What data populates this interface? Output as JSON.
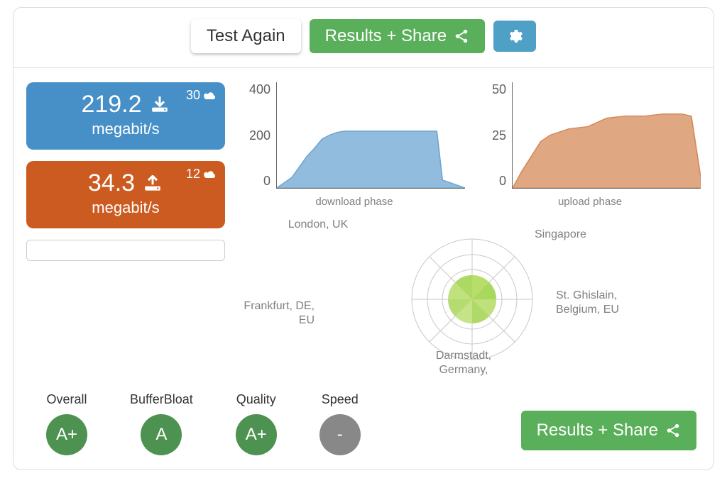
{
  "topbar": {
    "test_again": "Test Again",
    "results_share": "Results + Share"
  },
  "download": {
    "value": "219.2",
    "unit": "megabit/s",
    "servers": "30"
  },
  "upload": {
    "value": "34.3",
    "unit": "megabit/s",
    "servers": "12"
  },
  "chart_labels": {
    "download": "download phase",
    "upload": "upload phase"
  },
  "radar": {
    "london": "London, UK",
    "singapore": "Singapore",
    "ghislain": "St. Ghislain, Belgium, EU",
    "frankfurt": "Frankfurt, DE, EU",
    "darmstadt": "Darmstadt, Germany,"
  },
  "grades": {
    "overall": {
      "label": "Overall",
      "grade": "A+"
    },
    "bufferbloat": {
      "label": "BufferBloat",
      "grade": "A"
    },
    "quality": {
      "label": "Quality",
      "grade": "A+"
    },
    "speed": {
      "label": "Speed",
      "grade": "-"
    }
  },
  "bottom": {
    "results_share": "Results + Share"
  },
  "chart_data": [
    {
      "type": "area",
      "title": "download phase",
      "ylabel": "",
      "ylim": [
        0,
        400
      ],
      "yticks": [
        0,
        200,
        400
      ],
      "x": [
        0,
        0.08,
        0.12,
        0.16,
        0.2,
        0.24,
        0.28,
        0.32,
        0.36,
        0.85,
        0.88,
        1.0
      ],
      "values": [
        0,
        40,
        80,
        120,
        150,
        185,
        200,
        210,
        215,
        215,
        30,
        0
      ],
      "color": "#6da6d1"
    },
    {
      "type": "area",
      "title": "upload phase",
      "ylabel": "",
      "ylim": [
        0,
        50
      ],
      "yticks": [
        0,
        25,
        50
      ],
      "x": [
        0,
        0.05,
        0.1,
        0.15,
        0.2,
        0.3,
        0.4,
        0.5,
        0.6,
        0.7,
        0.8,
        0.9,
        0.95,
        1.0
      ],
      "values": [
        0,
        8,
        15,
        22,
        25,
        28,
        29,
        33,
        34,
        34,
        35,
        35,
        34,
        5
      ],
      "color": "#d58a5a"
    }
  ]
}
